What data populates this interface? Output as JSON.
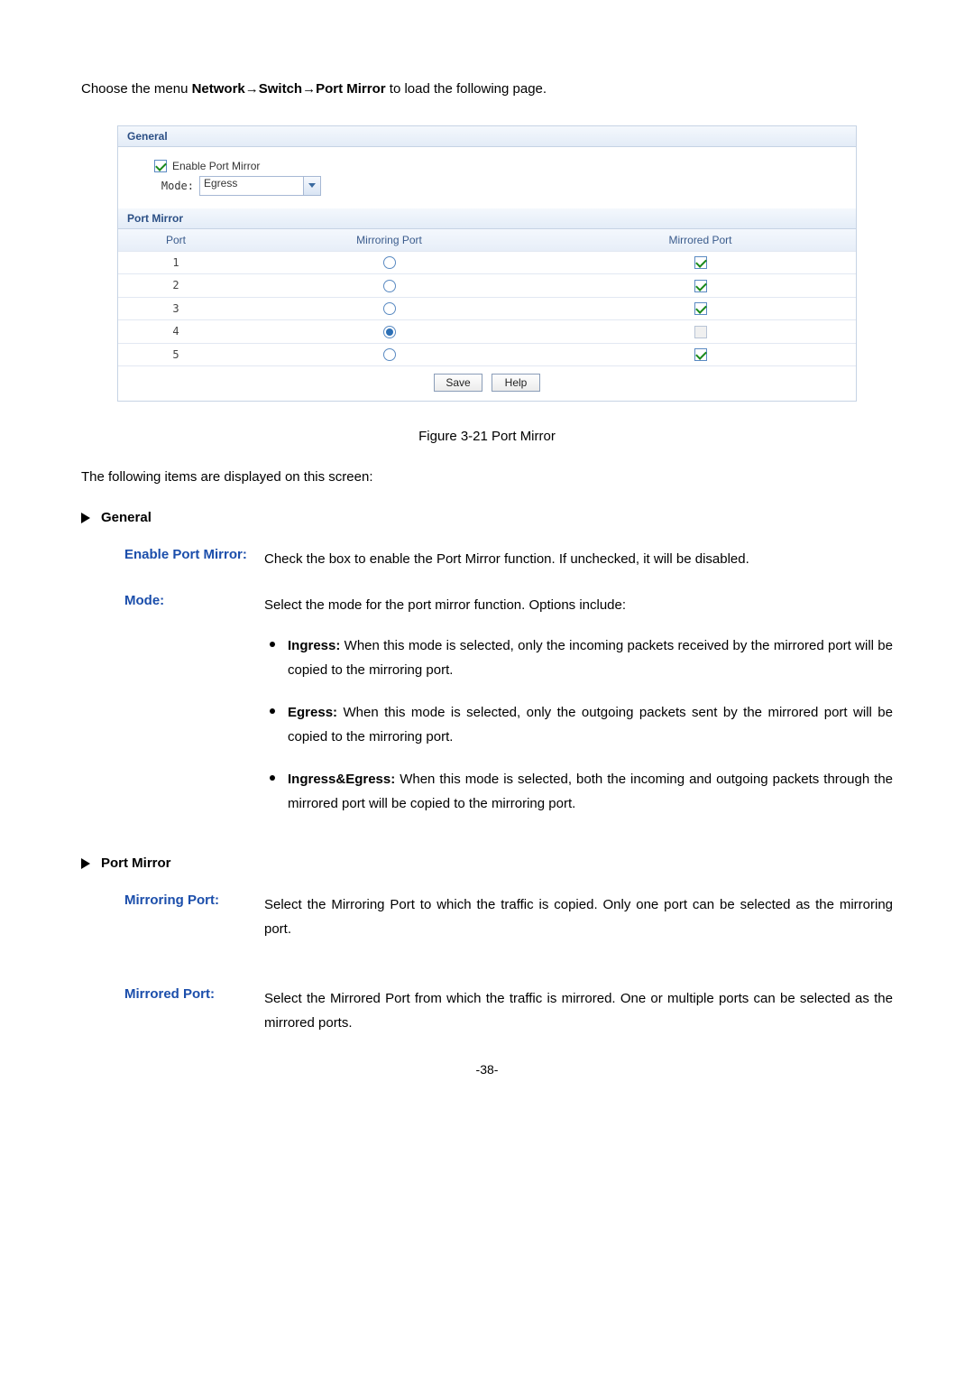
{
  "intro": {
    "prefix": "Choose the menu ",
    "path": "Network→Switch→Port Mirror",
    "suffix": " to load the following page."
  },
  "panel": {
    "general_title": "General",
    "enable_label": "Enable Port Mirror",
    "enable_checked": true,
    "mode_label": "Mode:",
    "mode_value": "Egress",
    "port_mirror_title": "Port Mirror",
    "columns": {
      "port": "Port",
      "mirroring": "Mirroring Port",
      "mirrored": "Mirrored Port"
    },
    "rows": [
      {
        "port": "1",
        "mirroring_selected": false,
        "mirrored_checked": true,
        "mirrored_disabled": false
      },
      {
        "port": "2",
        "mirroring_selected": false,
        "mirrored_checked": true,
        "mirrored_disabled": false
      },
      {
        "port": "3",
        "mirroring_selected": false,
        "mirrored_checked": true,
        "mirrored_disabled": false
      },
      {
        "port": "4",
        "mirroring_selected": true,
        "mirrored_checked": false,
        "mirrored_disabled": true
      },
      {
        "port": "5",
        "mirroring_selected": false,
        "mirrored_checked": true,
        "mirrored_disabled": false
      }
    ],
    "buttons": {
      "save": "Save",
      "help": "Help"
    }
  },
  "figure_caption": "Figure 3-21 Port Mirror",
  "items_intro": "The following items are displayed on this screen:",
  "sections": {
    "general": {
      "title": "General",
      "enable": {
        "label": "Enable Port Mirror:",
        "desc": "Check the box to enable the Port Mirror function. If unchecked, it will be disabled."
      },
      "mode": {
        "label": "Mode:",
        "desc": "Select the mode for the port mirror function. Options include:",
        "options": {
          "ingress_b": "Ingress:",
          "ingress_t": " When this mode is selected, only the incoming packets received by the mirrored port will be copied to the mirroring port.",
          "egress_b": "Egress:",
          "egress_t": " When this mode is selected, only the outgoing packets sent by the mirrored port will be copied to the mirroring port.",
          "both_b": "Ingress&Egress:",
          "both_t": " When this mode is selected, both the incoming and outgoing packets through the mirrored port will be copied to the mirroring port."
        }
      }
    },
    "port_mirror": {
      "title": "Port Mirror",
      "mirroring": {
        "label": "Mirroring Port:",
        "desc": "Select the Mirroring Port to which the traffic is copied. Only one port can be selected as the mirroring port."
      },
      "mirrored": {
        "label": "Mirrored Port:",
        "desc": "Select the Mirrored Port from which the traffic is mirrored. One or multiple ports can be selected as the mirrored ports."
      }
    }
  },
  "page_number": "-38-"
}
